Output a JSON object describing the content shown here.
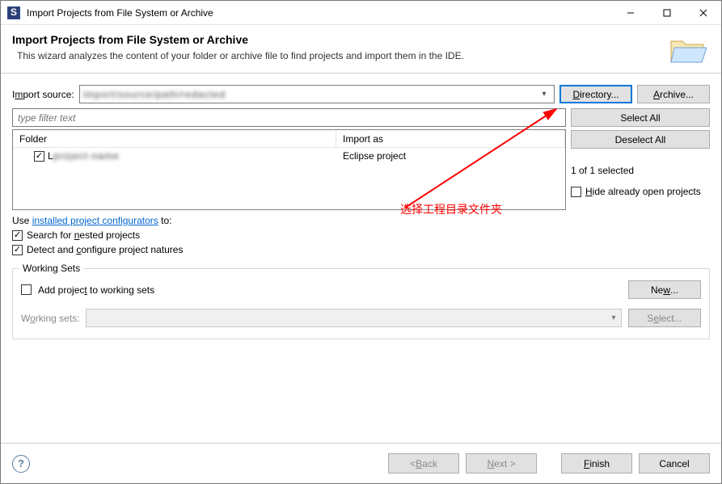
{
  "titlebar": {
    "title": "Import Projects from File System or Archive"
  },
  "header": {
    "title": "Import Projects from File System or Archive",
    "description": "This wizard analyzes the content of your folder or archive file to find projects and import them in the IDE."
  },
  "importSource": {
    "label": "Import source:",
    "value": "",
    "directory_btn": "Directory...",
    "archive_btn": "Archive..."
  },
  "filter": {
    "placeholder": "type filter text"
  },
  "table": {
    "col_folder": "Folder",
    "col_import": "Import as",
    "rows": [
      {
        "checked": true,
        "folder": "L",
        "import_as": "Eclipse project"
      }
    ]
  },
  "sidebuttons": {
    "select_all": "Select All",
    "deselect_all": "Deselect All",
    "selected_text": "1 of 1 selected",
    "hide_label": "Hide already open projects",
    "hide_checked": false
  },
  "configurators": {
    "use_prefix": "Use ",
    "link_text": "installed project configurators",
    "use_suffix": " to:",
    "search_nested": {
      "label": "Search for nested projects",
      "checked": true
    },
    "detect_natures": {
      "label": "Detect and configure project natures",
      "checked": true
    }
  },
  "working_sets": {
    "legend": "Working Sets",
    "add_label": "Add project to working sets",
    "add_checked": false,
    "new_btn": "New...",
    "sets_label": "Working sets:",
    "select_btn": "Select..."
  },
  "footer": {
    "back": "< Back",
    "next": "Next >",
    "finish": "Finish",
    "cancel": "Cancel"
  },
  "annotation": {
    "text": "选择工程目录文件夹"
  }
}
